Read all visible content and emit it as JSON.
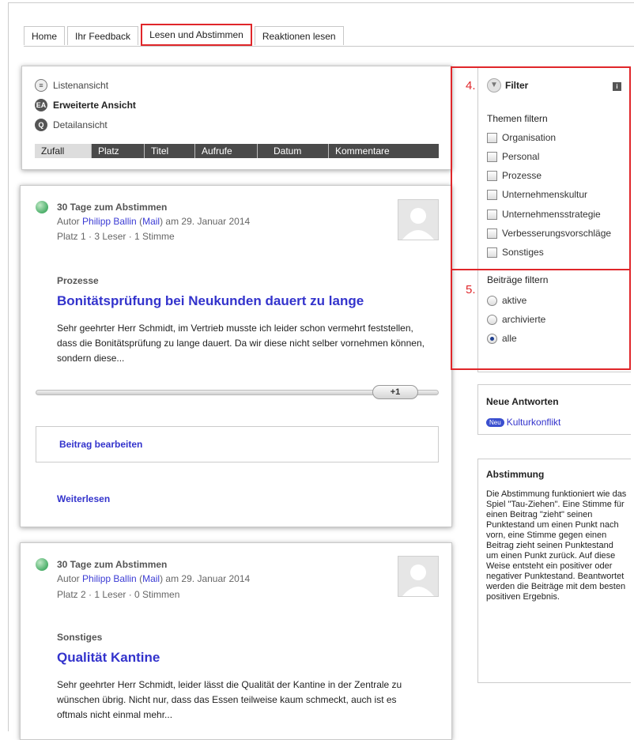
{
  "tabs": [
    {
      "label": "Home",
      "active": false
    },
    {
      "label": "Ihr Feedback",
      "active": false
    },
    {
      "label": "Lesen und Abstimmen",
      "active": true
    },
    {
      "label": "Reaktionen lesen",
      "active": false
    }
  ],
  "views": {
    "list": "Listenansicht",
    "extended": "Erweiterte Ansicht",
    "detail": "Detailansicht"
  },
  "sort": [
    "Zufall",
    "Platz",
    "Titel",
    "Aufrufe",
    "Datum",
    "Kommentare"
  ],
  "posts": [
    {
      "status": "30 Tage zum Abstimmen",
      "author_prefix": "Autor ",
      "author": "Philipp Ballin",
      "mail_open": " (",
      "mail": "Mail",
      "date": ") am 29. Januar 2014",
      "stats": "Platz 1 · 3 Leser · 1 Stimme",
      "category": "Prozesse",
      "title": "Bonitätsprüfung bei Neukunden dauert zu lange",
      "excerpt": "Sehr geehrter Herr Schmidt, im Vertrieb musste ich leider schon vermehrt feststellen, dass die Bonitätsprüfung zu lange dauert. Da wir diese nicht selber vornehmen können, sondern diese...",
      "vote": "+1",
      "edit": "Beitrag bearbeiten",
      "more": "Weiterlesen"
    },
    {
      "status": "30 Tage zum Abstimmen",
      "author_prefix": "Autor ",
      "author": "Philipp Ballin",
      "mail_open": " (",
      "mail": "Mail",
      "date": ") am 29. Januar 2014",
      "stats": "Platz 2 · 1 Leser · 0 Stimmen",
      "category": "Sonstiges",
      "title": "Qualität Kantine",
      "excerpt": "Sehr geehrter Herr Schmidt, leider lässt die Qualität der Kantine in der Zentrale zu wünschen übrig. Nicht nur, dass das Essen teilweise kaum schmeckt, auch ist es oftmals nicht einmal mehr..."
    }
  ],
  "filter": {
    "marker_themes": "4.",
    "marker_posts": "5.",
    "title": "Filter",
    "info": "i",
    "themes_title": "Themen filtern",
    "themes": [
      "Organisation",
      "Personal",
      "Prozesse",
      "Unternehmenskultur",
      "Unternehmensstrategie",
      "Verbesserungsvorschläge",
      "Sonstiges"
    ],
    "posts_title": "Beiträge filtern",
    "post_options": [
      "aktive",
      "archivierte",
      "alle"
    ],
    "selected": "alle"
  },
  "answers": {
    "title": "Neue Antworten",
    "badge": "Neu",
    "item": "Kulturkonflikt"
  },
  "voting": {
    "title": "Abstimmung",
    "text": "Die Abstimmung funktioniert wie das Spiel \"Tau-Ziehen\". Eine Stimme für einen Beitrag \"zieht\" seinen Punktestand um einen Punkt nach vorn, eine Stimme gegen einen Beitrag zieht seinen Punktestand um einen Punkt zurück. Auf diese Weise entsteht ein positiver oder negativer Punktestand. Beantwortet werden die Beiträge mit dem besten positiven Ergebnis."
  },
  "colors": {
    "link": "#3333cc",
    "highlight": "#e0262a",
    "sortbar": "#4a4a4a"
  }
}
